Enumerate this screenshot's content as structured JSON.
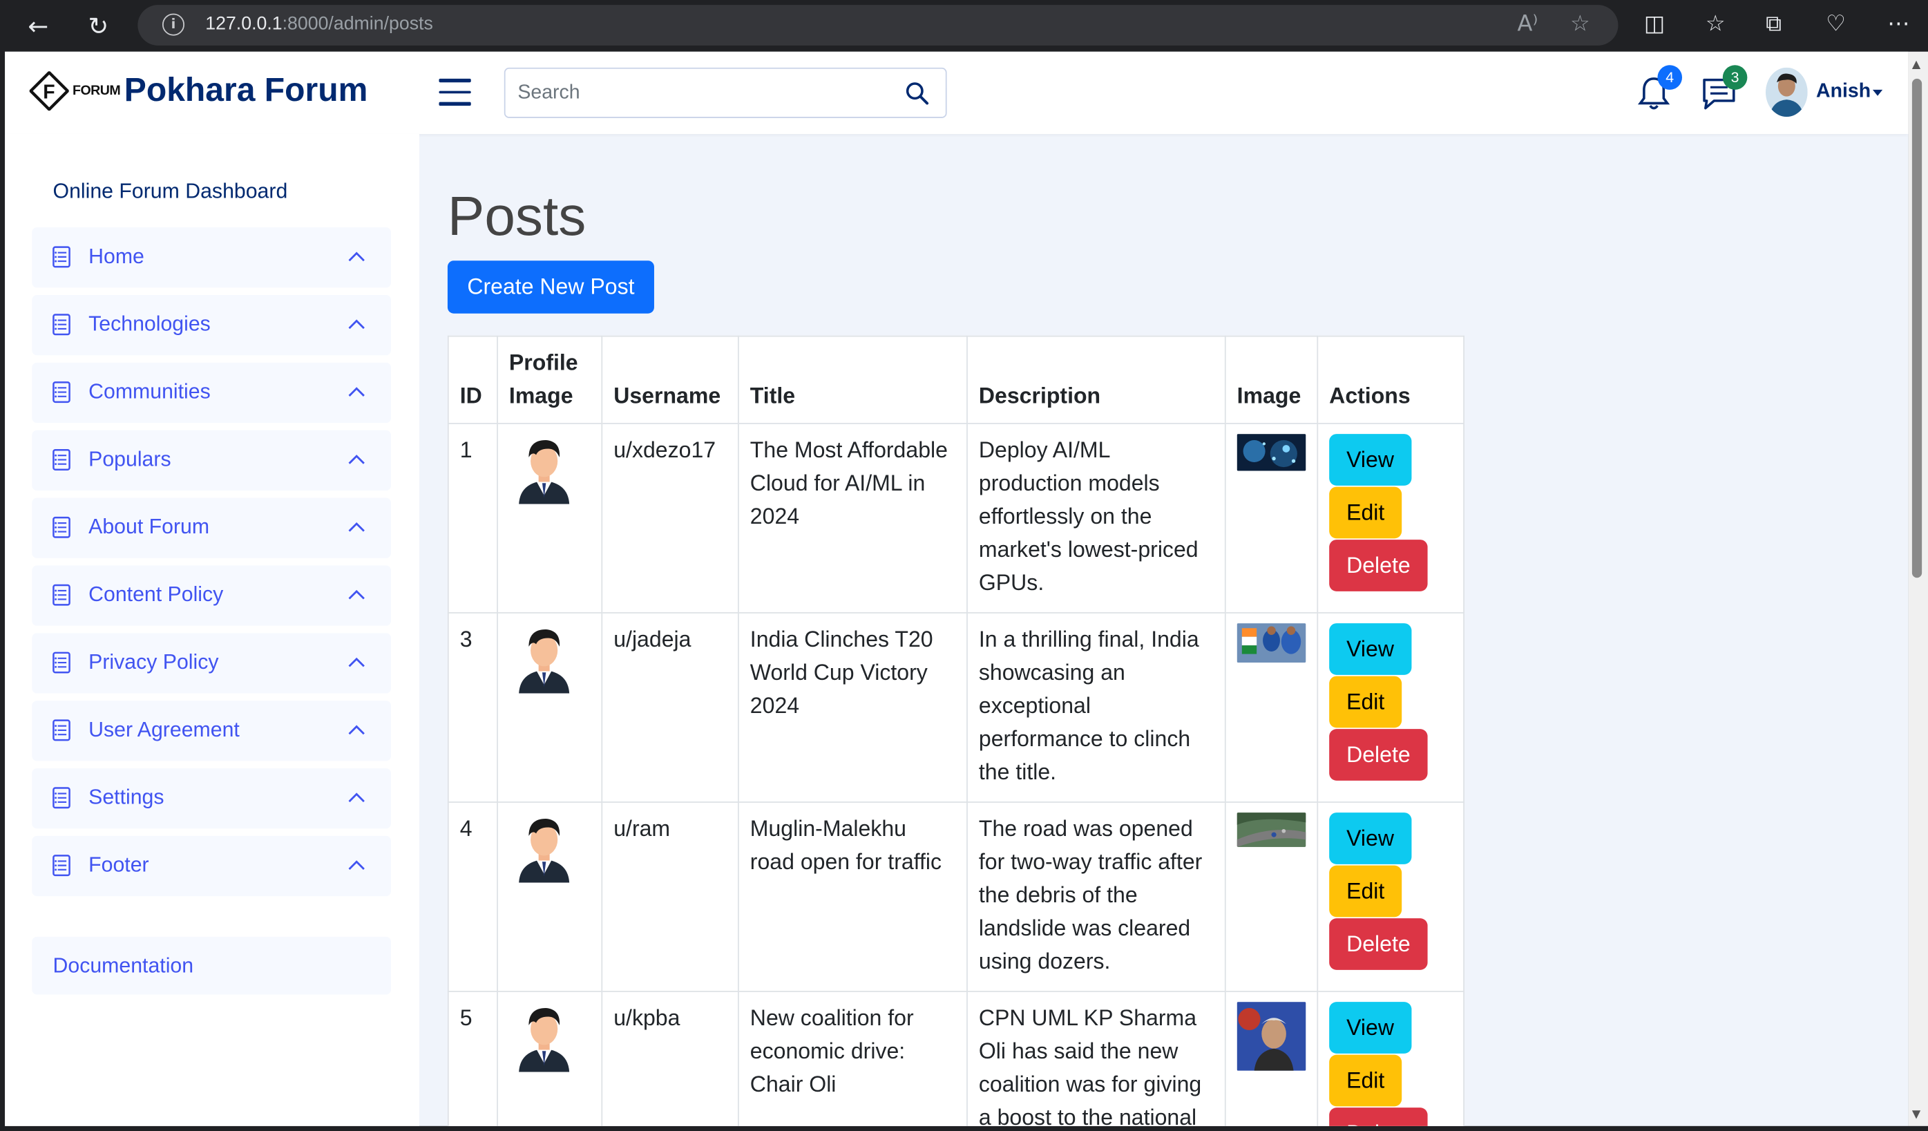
{
  "browser": {
    "url_host": "127.0.0.1",
    "url_rest": ":8000/admin/posts"
  },
  "header": {
    "logo_small": "FORUM",
    "brand": "Pokhara Forum",
    "search_placeholder": "Search",
    "notifications_count": "4",
    "messages_count": "3",
    "user_name": "Anish",
    "colors": {
      "brand": "#012970",
      "notif_badge": "#0d6efd",
      "msg_badge": "#198754"
    }
  },
  "sidebar": {
    "title": "Online Forum Dashboard",
    "items": [
      {
        "label": "Home"
      },
      {
        "label": "Technologies"
      },
      {
        "label": "Communities"
      },
      {
        "label": "Populars"
      },
      {
        "label": "About Forum"
      },
      {
        "label": "Content Policy"
      },
      {
        "label": "Privacy Policy"
      },
      {
        "label": "User Agreement"
      },
      {
        "label": "Settings"
      },
      {
        "label": "Footer"
      }
    ],
    "documentation": "Documentation"
  },
  "main": {
    "title": "Posts",
    "create_button": "Create New Post",
    "columns": [
      "ID",
      "Profile Image",
      "Username",
      "Title",
      "Description",
      "Image",
      "Actions"
    ],
    "actions": {
      "view": "View",
      "edit": "Edit",
      "delete": "Delete"
    },
    "rows": [
      {
        "id": "1",
        "username": "u/xdezo17",
        "title": "The Most Affordable Cloud for AI/ML in 2024",
        "description": "Deploy AI/ML production models effortlessly on the market's lowest-priced GPUs."
      },
      {
        "id": "3",
        "username": "u/jadeja",
        "title": "India Clinches T20 World Cup Victory 2024",
        "description": "In a thrilling final, India showcasing an exceptional performance to clinch the title."
      },
      {
        "id": "4",
        "username": "u/ram",
        "title": "Muglin-Malekhu road open for traffic",
        "description": "The road was opened for two-way traffic after the debris of the landslide was cleared using dozers."
      },
      {
        "id": "5",
        "username": "u/kpba",
        "title": "New coalition for economic drive: Chair Oli",
        "description": "CPN UML KP Sharma Oli has said the new coalition was for giving a boost to the national"
      }
    ]
  }
}
